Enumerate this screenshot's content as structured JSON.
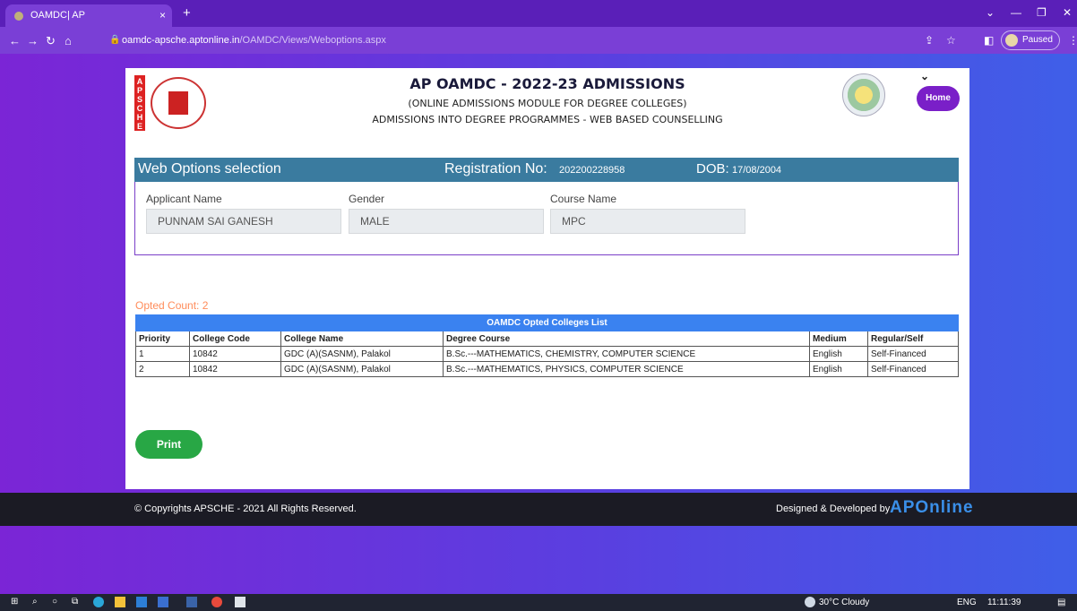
{
  "browser": {
    "tab_title": "OAMDC| AP",
    "tab_close": "×",
    "new_tab": "+",
    "url_host": "oamdc-apsche.aptonline.in",
    "url_path": "/OAMDC/Views/Weboptions.aspx",
    "profile_status": "Paused"
  },
  "header": {
    "logo_strip": "APSCHE",
    "title": "AP OAMDC - 2022-23 ADMISSIONS",
    "subtitle1": "(ONLINE ADMISSIONS MODULE FOR DEGREE COLLEGES)",
    "subtitle2": "ADMISSIONS INTO DEGREE PROGRAMMES - WEB BASED COUNSELLING",
    "home_label": "Home"
  },
  "web_options": {
    "title": "Web Options selection",
    "registration_label": "Registration No:",
    "registration_value": "202200228958",
    "dob_label": "DOB:",
    "dob_value": "17/08/2004"
  },
  "applicant": {
    "name_label": "Applicant Name",
    "name_value": "PUNNAM SAI GANESH",
    "gender_label": "Gender",
    "gender_value": "MALE",
    "course_label": "Course Name",
    "course_value": "MPC"
  },
  "opted_count": "Opted Count: 2",
  "colleges_table": {
    "caption": "OAMDC Opted Colleges List",
    "headers": [
      "Priority",
      "College Code",
      "College Name",
      "Degree Course",
      "Medium",
      "Regular/Self"
    ],
    "rows": [
      [
        "1",
        "10842",
        "GDC (A)(SASNM), Palakol",
        "B.Sc.---MATHEMATICS, CHEMISTRY, COMPUTER SCIENCE",
        "English",
        "Self-Financed"
      ],
      [
        "2",
        "10842",
        "GDC (A)(SASNM), Palakol",
        "B.Sc.---MATHEMATICS, PHYSICS, COMPUTER SCIENCE",
        "English",
        "Self-Financed"
      ]
    ]
  },
  "print_label": "Print",
  "footer": {
    "copyright": "© Copyrights APSCHE - 2021 All Rights Reserved.",
    "developed_by": "Designed & Developed by",
    "brand": "APOnline"
  },
  "taskbar": {
    "weather": "30°C Cloudy",
    "language": "ENG",
    "time": "11:11:39"
  },
  "colors": {
    "page_gradient_start": "#7b25d6",
    "page_gradient_end": "#3f5fe8",
    "section_header": "#3a7b9f",
    "table_caption": "#3a82f0",
    "print_button": "#28a745",
    "home_button": "#7a1fc8",
    "opted_text": "#ff8c5a"
  }
}
